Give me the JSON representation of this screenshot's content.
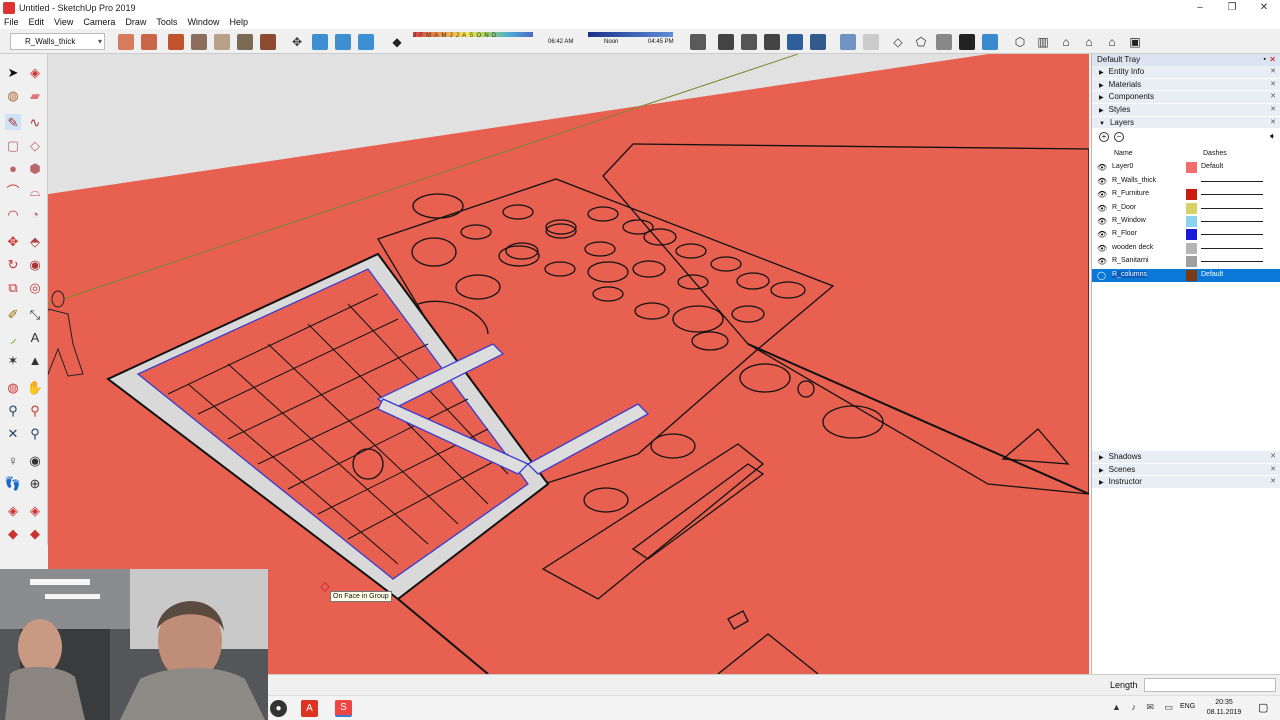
{
  "window": {
    "title": "Untitled - SketchUp Pro 2019",
    "controls": [
      "–",
      "❐",
      "✕"
    ]
  },
  "menu": [
    "File",
    "Edit",
    "View",
    "Camera",
    "Draw",
    "Tools",
    "Window",
    "Help"
  ],
  "toolbar": {
    "layer_select": "R_Walls_thick",
    "months": "JFMAMJJASOND",
    "time_left": "06:42 AM",
    "time_mid": "Noon",
    "time_right": "04:45 PM"
  },
  "viewport": {
    "tooltip": "On Face in Group",
    "background": "#e8604f"
  },
  "tray": {
    "title": "Default Tray",
    "panels_top": [
      "Entity Info",
      "Materials",
      "Components",
      "Styles"
    ],
    "layers_panel": "Layers",
    "columns": {
      "name": "Name",
      "dashes": "Dashes"
    },
    "layers": [
      {
        "name": "Layer0",
        "color": "#f26c6c",
        "dash": "Default",
        "visible": true,
        "selected": false
      },
      {
        "name": "R_Walls_thick",
        "color": "#ffffff",
        "dash": "",
        "visible": true,
        "selected": false
      },
      {
        "name": "R_Furniture",
        "color": "#cc1b10",
        "dash": "",
        "visible": true,
        "selected": false
      },
      {
        "name": "R_Door",
        "color": "#d7d067",
        "dash": "",
        "visible": true,
        "selected": false
      },
      {
        "name": "R_Window",
        "color": "#8ad3ef",
        "dash": "",
        "visible": true,
        "selected": false
      },
      {
        "name": "R_Floor",
        "color": "#1919d8",
        "dash": "",
        "visible": true,
        "selected": false
      },
      {
        "name": "wooden deck",
        "color": "#b5b5b5",
        "dash": "",
        "visible": true,
        "selected": false
      },
      {
        "name": "R_Sanitarni",
        "color": "#9f9f9f",
        "dash": "",
        "visible": true,
        "selected": false
      },
      {
        "name": "R_columns",
        "color": "#7b3b12",
        "dash": "Default",
        "visible": false,
        "selected": true
      }
    ],
    "panels_bottom": [
      "Shadows",
      "Scenes",
      "Instructor"
    ]
  },
  "status": {
    "length_label": "Length",
    "length_value": ""
  },
  "taskbar": {
    "lang": "ENG",
    "time": "20:35",
    "date": "08.11.2019"
  },
  "colors": {
    "selection": "#0a78d8",
    "accent": "#e8604f"
  }
}
